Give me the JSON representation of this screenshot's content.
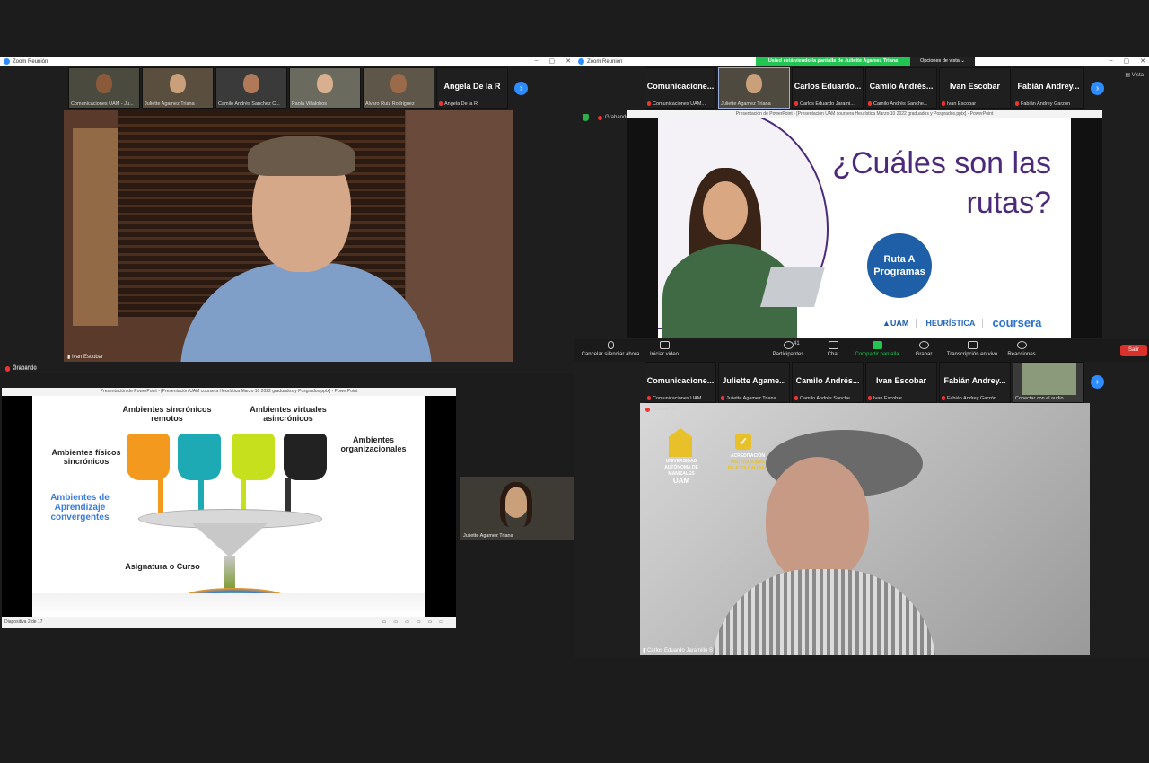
{
  "win1": {
    "title": "Zoom Reunión",
    "thumbs": [
      {
        "name": "Comunicaciones UAM - Ju..."
      },
      {
        "name": "Juliette Agamez Triana"
      },
      {
        "name": "Camilo Andrés Sanchez C..."
      },
      {
        "name": "Paola Villalobos"
      },
      {
        "name": "Alvaro Ruiz Rodriguez"
      }
    ],
    "text_thumb": {
      "big": "Angela De la R",
      "name": "Angela De la R"
    },
    "speaker_name": "Ivan Escobar",
    "recording": "Grabando"
  },
  "win2": {
    "title": "Zoom Reunión",
    "banner": "Usted está viendo la pantalla de Juliette Agamez Triana",
    "view_options": "Opciones de vista ⌄",
    "view_label": "Vista",
    "thumbs": [
      {
        "big": "Comunicacione...",
        "name": "Comunicaciones UAM..."
      },
      {
        "big": "",
        "name": "Juliette Agamez Triana"
      },
      {
        "big": "Carlos Eduardo...",
        "name": "Carlos Eduardo Jarami..."
      },
      {
        "big": "Camilo Andrés...",
        "name": "Camilo Andrés Sanche..."
      },
      {
        "big": "Ivan Escobar",
        "name": "Ivan Escobar"
      },
      {
        "big": "Fabián Andrey...",
        "name": "Fabián Andrey Garzón"
      }
    ],
    "recording": "Grabando",
    "ppt_title": "Presentación de PowerPoint - [Presentación UAM coursera Heurística Marzo 10 2022 graduados y Posgrados.pptx] - PowerPoint",
    "slide": {
      "heading1": "¿Cuáles son las",
      "heading2": "rutas?",
      "route_label1": "Ruta A",
      "route_label2": "Programas",
      "logo_uam": "UAM",
      "logo_heuristica": "HEURÍSTICA",
      "logo_coursera": "coursera"
    },
    "toolbar": [
      {
        "label": "Cancelar silenciar ahora",
        "badge": ""
      },
      {
        "label": "Iniciar video",
        "badge": ""
      },
      {
        "label": "Participantes",
        "badge": "41"
      },
      {
        "label": "Chat",
        "badge": ""
      },
      {
        "label": "Compartir pantalla",
        "badge": ""
      },
      {
        "label": "Grabar",
        "badge": ""
      },
      {
        "label": "Transcripción en vivo",
        "badge": ""
      },
      {
        "label": "Reacciones",
        "badge": ""
      }
    ],
    "leave": "Salir"
  },
  "win3": {
    "ppt_title": "Presentación de PowerPoint - [Presentación UAM coursera Heurística Marzo 10 2022 graduados y Posgrados.pptx] - PowerPoint",
    "slide": {
      "label_sincronicos_remotos": "Ambientes sincrónicos remotos",
      "label_virtuales": "Ambientes virtuales asincrónicos",
      "label_fisicos": "Ambientes físicos sincrónicos",
      "label_organizacionales": "Ambientes organizacionales",
      "label_convergentes": "Ambientes de Aprendizaje convergentes",
      "label_asignatura": "Asignatura o Curso"
    },
    "status": "Diapositiva 2 de 17",
    "recording": "Grabando"
  },
  "floating_cam": {
    "name": "Juliette Agamez Triana"
  },
  "win4": {
    "thumbs": [
      {
        "big": "Comunicacione...",
        "name": "Comunicaciones UAM..."
      },
      {
        "big": "Juliette Agame...",
        "name": "Juliette Agamez Triana"
      },
      {
        "big": "Camilo Andrés...",
        "name": "Camilo Andrés Sanche..."
      },
      {
        "big": "Ivan Escobar",
        "name": "Ivan Escobar"
      },
      {
        "big": "Fabián Andrey...",
        "name": "Fabián Andrey Garzón"
      },
      {
        "big": "",
        "name": "Conectar con el audio..."
      }
    ],
    "recording": "Grabando",
    "speaker_name": "Carlos Eduardo Jaramillo S",
    "bg_logo": {
      "line1": "UNIVERSIDAD",
      "line2": "AUTÓNOMA DE",
      "line3": "MANIZALES",
      "line4": "UAM",
      "acred1": "ACREDITACIÓN",
      "acred2": "INSTITUCIONAL",
      "acred3": "DE ALTA CALIDAD"
    }
  },
  "colors": {
    "zoom_blue": "#2d8cff",
    "slide_purple": "#4b2a7a",
    "route_blue": "#1f5fa8",
    "green_banner": "#23c552",
    "leave_red": "#d9312b"
  }
}
